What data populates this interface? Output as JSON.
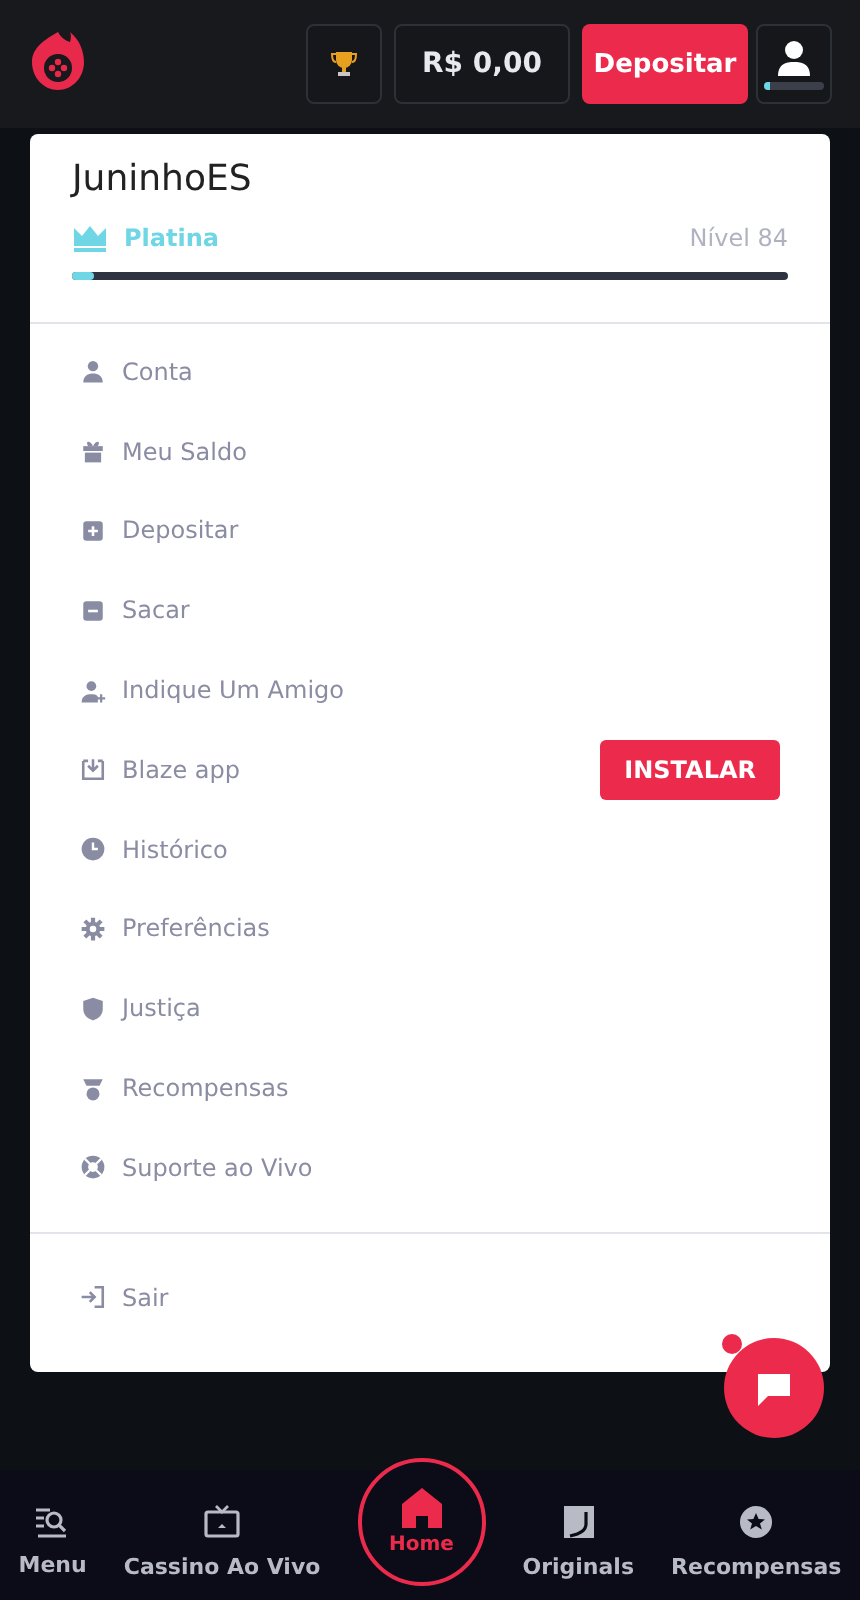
{
  "header": {
    "balance": "R$ 0,00",
    "deposit_button": "Depositar"
  },
  "profile": {
    "username": "JuninhoES",
    "tier": "Platina",
    "level_text": "Nível 84",
    "level": 0.03
  },
  "menu": [
    {
      "label": "Conta"
    },
    {
      "label": "Meu Saldo"
    },
    {
      "label": "Depositar"
    },
    {
      "label": "Sacar"
    },
    {
      "label": "Indique Um Amigo"
    },
    {
      "label": "Blaze app",
      "action": "INSTALAR"
    },
    {
      "label": "Histórico"
    },
    {
      "label": "Preferências"
    },
    {
      "label": "Justiça"
    },
    {
      "label": "Recompensas"
    },
    {
      "label": "Suporte ao Vivo"
    }
  ],
  "logout": "Sair",
  "bottom_nav": [
    {
      "label": "Menu",
      "selected": false
    },
    {
      "label": "Cassino Ao Vivo",
      "selected": false
    },
    {
      "label": "Home",
      "selected": true
    },
    {
      "label": "Originals",
      "selected": false
    },
    {
      "label": "Recompensas",
      "selected": false
    }
  ]
}
